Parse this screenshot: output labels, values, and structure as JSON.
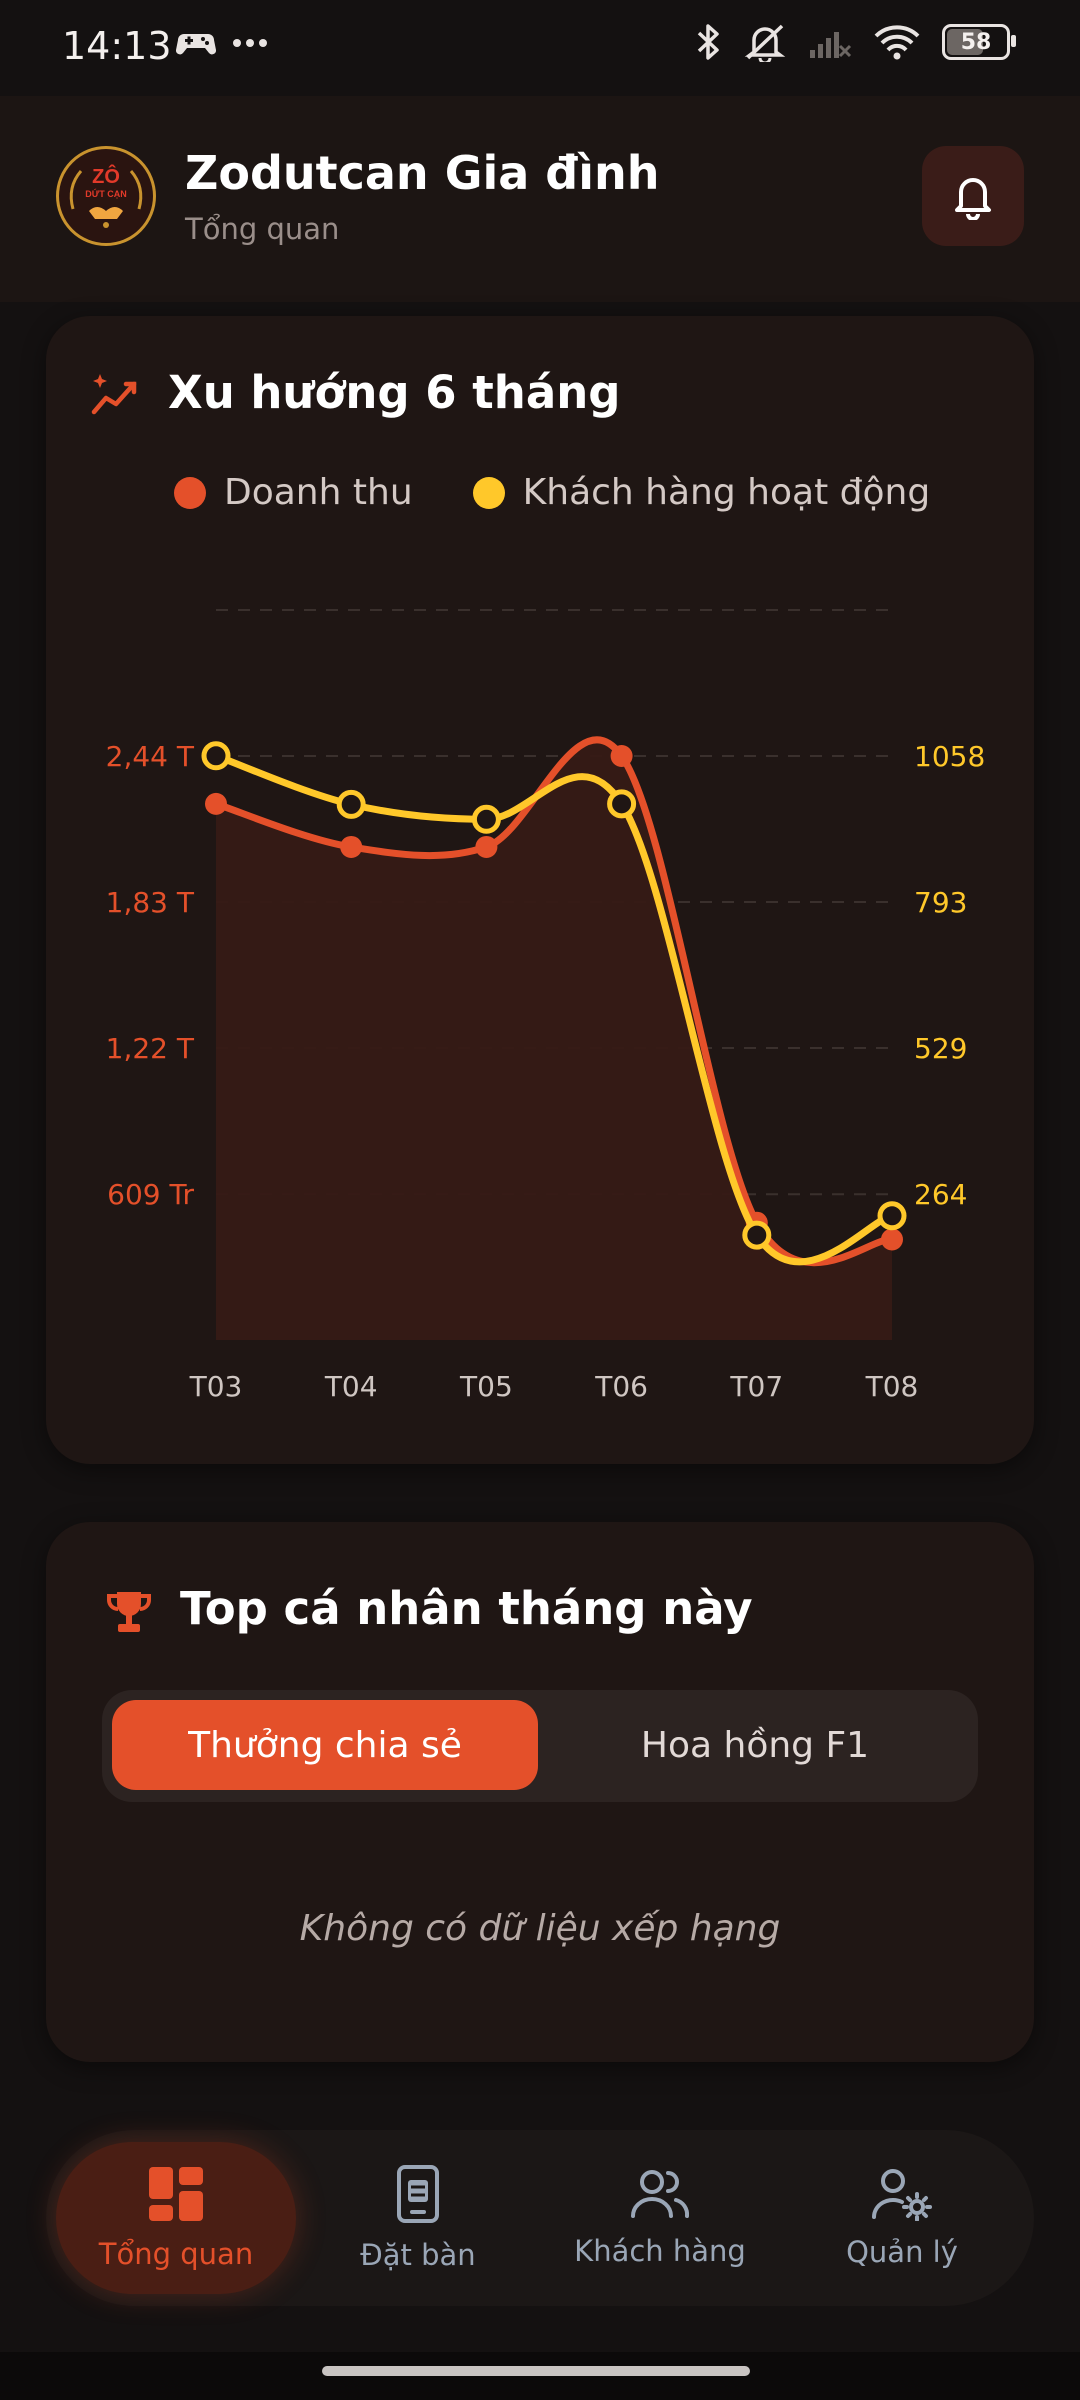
{
  "status_bar": {
    "time": "14:13",
    "battery": "58",
    "icons": [
      "game-controller-icon",
      "more-dots-icon",
      "bluetooth-icon",
      "bell-muted-icon",
      "signal-icon",
      "wifi-icon",
      "battery-icon"
    ]
  },
  "header": {
    "title": "Zodutcan Gia đình",
    "subtitle": "Tổng quan",
    "logo_text_top": "ZÔ",
    "logo_text_bottom": "DỨT CẠN"
  },
  "trend_card": {
    "title": "Xu hướng 6 tháng",
    "icon": "trend-sparkle-icon"
  },
  "chart_data": {
    "type": "line",
    "categories": [
      "T03",
      "T04",
      "T05",
      "T06",
      "T07",
      "T08"
    ],
    "series": [
      {
        "name": "Doanh thu",
        "color": "#e4502a",
        "axis": "left",
        "values": [
          2240000000,
          2060000000,
          2060000000,
          2440000000,
          490000000,
          420000000
        ]
      },
      {
        "name": "Khách hàng hoạt động",
        "color": "#ffc82a",
        "axis": "right",
        "values": [
          1058,
          970,
          943,
          971,
          190,
          225
        ]
      }
    ],
    "y_left_ticks": [
      "609 Tr",
      "1,22 T",
      "1,83 T",
      "2,44 T"
    ],
    "y_left_tick_values": [
      609000000,
      1220000000,
      1830000000,
      2440000000
    ],
    "y_right_ticks": [
      "264",
      "529",
      "793",
      "1058"
    ],
    "y_right_tick_values": [
      264,
      529,
      793,
      1058
    ],
    "ylim_left": [
      0,
      3050000000
    ],
    "ylim_right": [
      0,
      1322
    ],
    "grid": true,
    "legend": "top"
  },
  "top_card": {
    "title": "Top cá nhân tháng này",
    "icon": "trophy-icon",
    "tabs": [
      {
        "label": "Thưởng chia sẻ",
        "active": true
      },
      {
        "label": "Hoa hồng F1",
        "active": false
      }
    ],
    "empty_message": "Không có dữ liệu xếp hạng"
  },
  "bottom_nav": {
    "items": [
      {
        "label": "Tổng quan",
        "icon": "dashboard-icon",
        "active": true
      },
      {
        "label": "Đặt bàn",
        "icon": "table-booking-icon",
        "active": false
      },
      {
        "label": "Khách hàng",
        "icon": "customers-icon",
        "active": false
      },
      {
        "label": "Quản lý",
        "icon": "user-settings-icon",
        "active": false
      }
    ]
  },
  "colors": {
    "accent": "#e4502a",
    "secondary": "#ffc82a",
    "background": "#141111",
    "card": "#1f1614"
  }
}
